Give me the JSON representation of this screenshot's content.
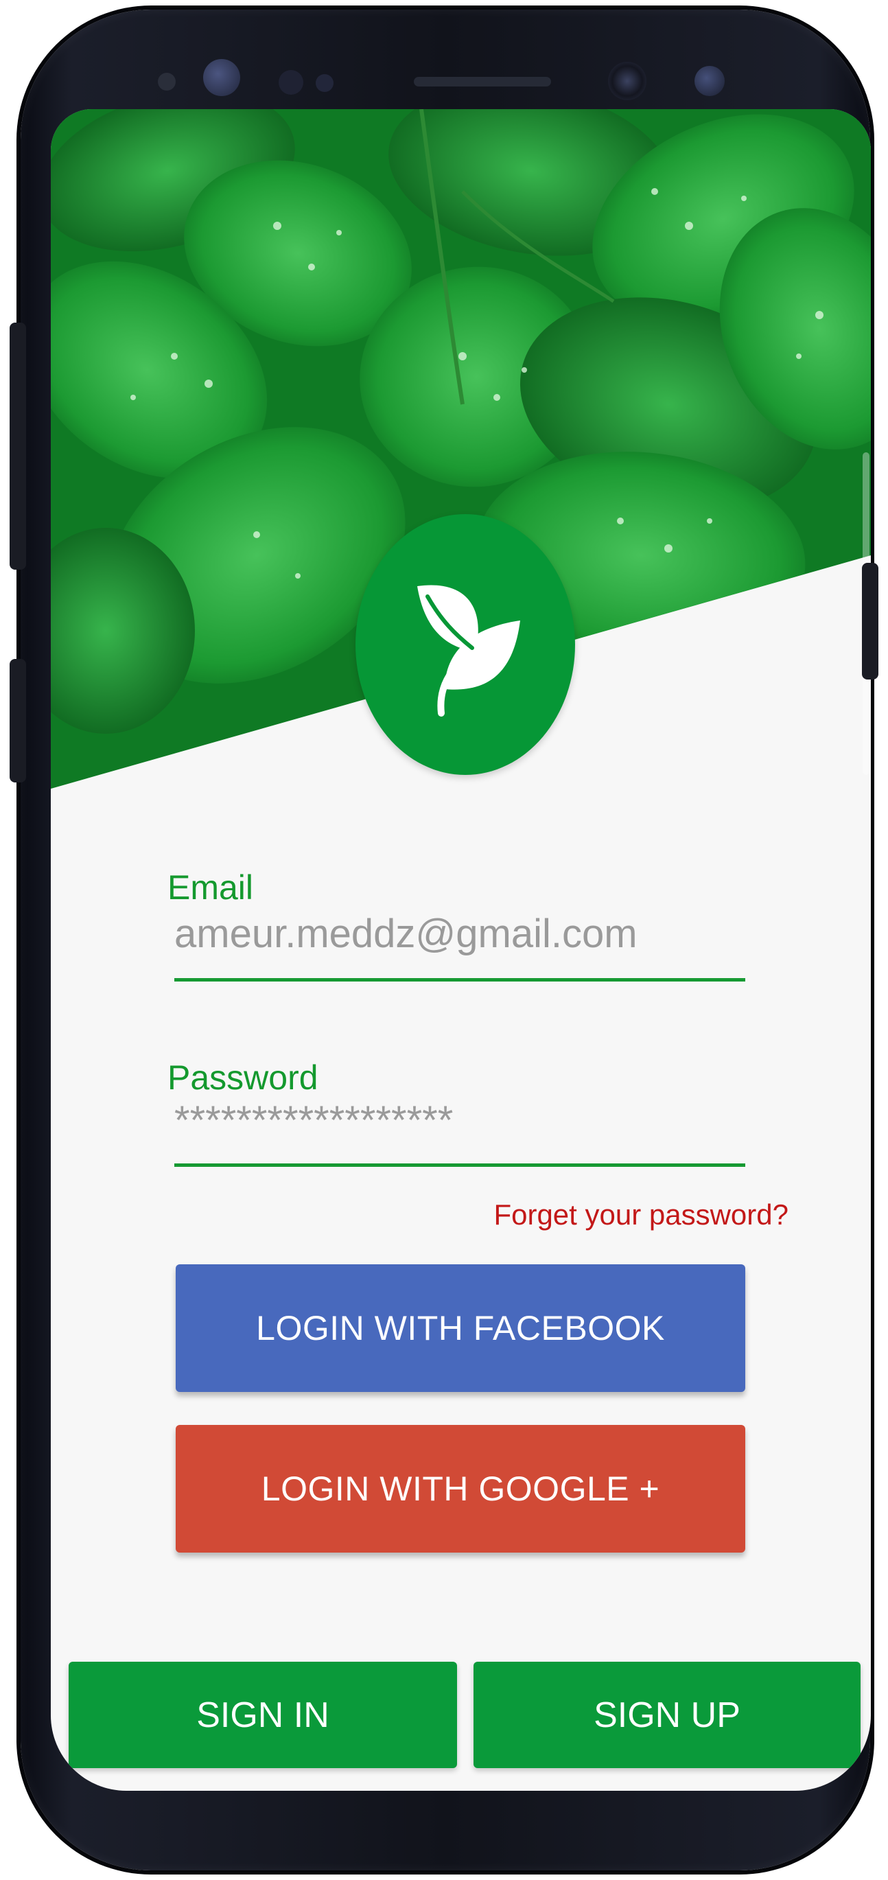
{
  "form": {
    "email_label": "Email",
    "email_value": "ameur.meddz@gmail.com",
    "password_label": "Password",
    "password_value": "******************",
    "forgot_link": "Forget your password?"
  },
  "social": {
    "facebook_label": "LOGIN WITH FACEBOOK",
    "google_label": "LOGIN WITH GOOGLE +"
  },
  "footer": {
    "signin_label": "SIGN IN",
    "signup_label": "SIGN UP"
  },
  "colors": {
    "brand_green": "#069736",
    "label_green": "#14992e",
    "facebook_blue": "#4869bd",
    "google_red": "#d14a36",
    "link_red": "#c31818"
  },
  "icons": {
    "logo": "leaf-icon"
  }
}
